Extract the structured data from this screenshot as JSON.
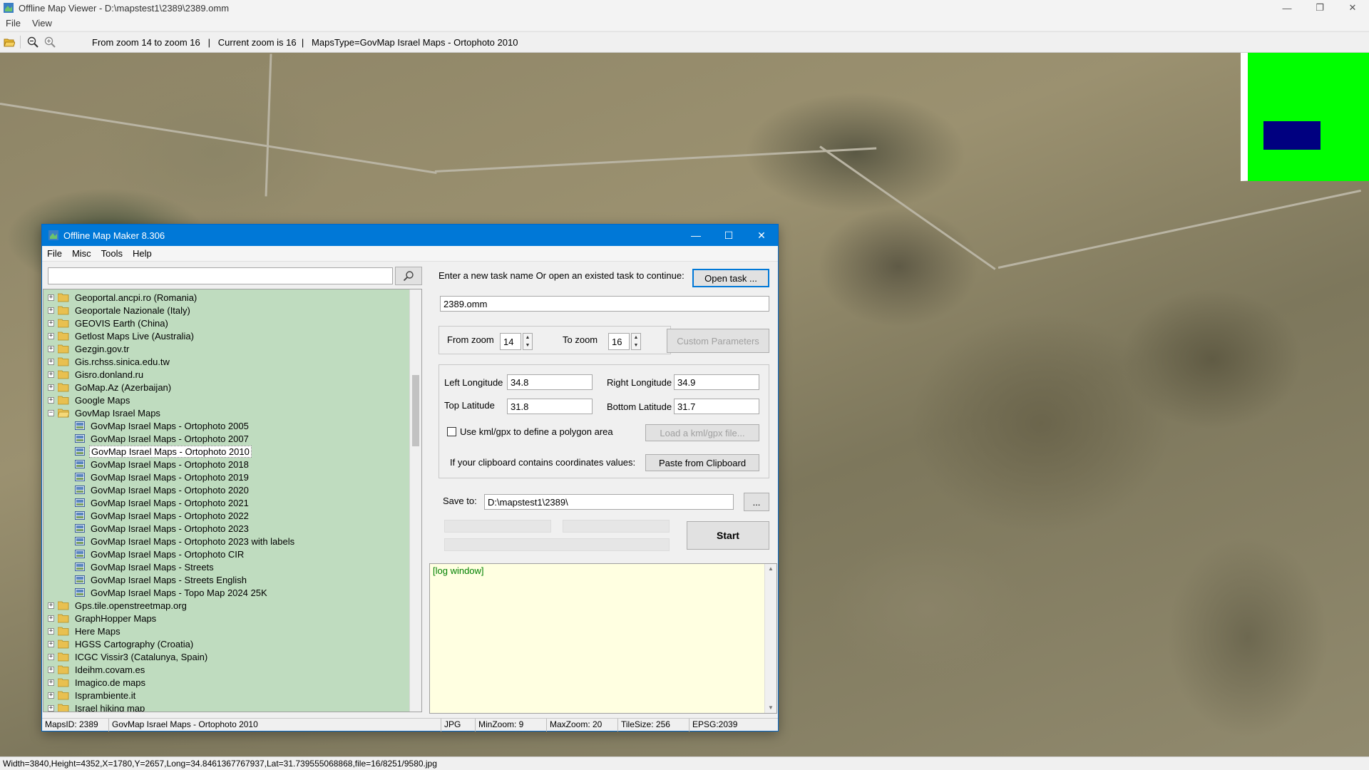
{
  "viewer": {
    "title": "Offline Map Viewer - D:\\mapstest1\\2389\\2389.omm",
    "menu": [
      "File",
      "View"
    ],
    "toolbar_info": "From zoom 14 to zoom 16   |   Current zoom is 16  |   MapsType=GovMap Israel Maps - Ortophoto 2010",
    "status": "Width=3840,Height=4352,X=1780,Y=2657,Long=34.8461367767937,Lat=31.739555068868,file=16/8251/9580.jpg"
  },
  "dialog": {
    "title": "Offline Map Maker 8.306",
    "menu": [
      "File",
      "Misc",
      "Tools",
      "Help"
    ],
    "search": {
      "value": "",
      "placeholder": ""
    },
    "tree": [
      {
        "label": "Geoportal.ancpi.ro (Romania)",
        "type": "folder",
        "level": 0,
        "expander": "+"
      },
      {
        "label": "Geoportale Nazionale (Italy)",
        "type": "folder",
        "level": 0,
        "expander": "+"
      },
      {
        "label": "GEOVIS Earth (China)",
        "type": "folder",
        "level": 0,
        "expander": "+"
      },
      {
        "label": "Getlost Maps Live (Australia)",
        "type": "folder",
        "level": 0,
        "expander": "+"
      },
      {
        "label": "Gezgin.gov.tr",
        "type": "folder",
        "level": 0,
        "expander": "+"
      },
      {
        "label": "Gis.rchss.sinica.edu.tw",
        "type": "folder",
        "level": 0,
        "expander": "+"
      },
      {
        "label": "Gisro.donland.ru",
        "type": "folder",
        "level": 0,
        "expander": "+"
      },
      {
        "label": "GoMap.Az (Azerbaijan)",
        "type": "folder",
        "level": 0,
        "expander": "+"
      },
      {
        "label": "Google Maps",
        "type": "folder",
        "level": 0,
        "expander": "+"
      },
      {
        "label": "GovMap Israel Maps",
        "type": "folder-open",
        "level": 0,
        "expander": "−"
      },
      {
        "label": "GovMap Israel Maps - Ortophoto 2005",
        "type": "map",
        "level": 1
      },
      {
        "label": "GovMap Israel Maps - Ortophoto 2007",
        "type": "map",
        "level": 1
      },
      {
        "label": "GovMap Israel Maps - Ortophoto 2010",
        "type": "map",
        "level": 1,
        "selected": true
      },
      {
        "label": "GovMap Israel Maps - Ortophoto 2018",
        "type": "map",
        "level": 1
      },
      {
        "label": "GovMap Israel Maps - Ortophoto 2019",
        "type": "map",
        "level": 1
      },
      {
        "label": "GovMap Israel Maps - Ortophoto 2020",
        "type": "map",
        "level": 1
      },
      {
        "label": "GovMap Israel Maps - Ortophoto 2021",
        "type": "map",
        "level": 1
      },
      {
        "label": "GovMap Israel Maps - Ortophoto 2022",
        "type": "map",
        "level": 1
      },
      {
        "label": "GovMap Israel Maps - Ortophoto 2023",
        "type": "map",
        "level": 1
      },
      {
        "label": "GovMap Israel Maps - Ortophoto 2023 with labels",
        "type": "map",
        "level": 1
      },
      {
        "label": "GovMap Israel Maps - Ortophoto CIR",
        "type": "map",
        "level": 1
      },
      {
        "label": "GovMap Israel Maps - Streets",
        "type": "map",
        "level": 1
      },
      {
        "label": "GovMap Israel Maps - Streets English",
        "type": "map",
        "level": 1
      },
      {
        "label": "GovMap Israel Maps - Topo Map 2024 25K",
        "type": "map",
        "level": 1
      },
      {
        "label": "Gps.tile.openstreetmap.org",
        "type": "folder",
        "level": 0,
        "expander": "+"
      },
      {
        "label": "GraphHopper Maps",
        "type": "folder",
        "level": 0,
        "expander": "+"
      },
      {
        "label": "Here Maps",
        "type": "folder",
        "level": 0,
        "expander": "+"
      },
      {
        "label": "HGSS Cartography (Croatia)",
        "type": "folder",
        "level": 0,
        "expander": "+"
      },
      {
        "label": "ICGC Vissir3 (Catalunya, Spain)",
        "type": "folder",
        "level": 0,
        "expander": "+"
      },
      {
        "label": "Ideihm.covam.es",
        "type": "folder",
        "level": 0,
        "expander": "+"
      },
      {
        "label": "Imagico.de maps",
        "type": "folder",
        "level": 0,
        "expander": "+"
      },
      {
        "label": "Isprambiente.it",
        "type": "folder",
        "level": 0,
        "expander": "+"
      },
      {
        "label": "Israel hiking map",
        "type": "folder",
        "level": 0,
        "expander": "+"
      }
    ],
    "task_prompt": "Enter a new task name Or open an existed task to continue:",
    "open_task_label": "Open task ...",
    "task_name": "2389.omm",
    "from_zoom_label": "From zoom",
    "from_zoom": "14",
    "to_zoom_label": "To zoom",
    "to_zoom": "16",
    "custom_params_label": "Custom Parameters",
    "left_long_label": "Left Longitude",
    "left_long": "34.8",
    "right_long_label": "Right Longitude",
    "right_long": "34.9",
    "top_lat_label": "Top Latitude",
    "top_lat": "31.8",
    "bottom_lat_label": "Bottom Latitude",
    "bottom_lat": "31.7",
    "kml_checkbox_label": "Use kml/gpx to define a polygon area",
    "load_kml_label": "Load a kml/gpx file...",
    "clipboard_text": "If your clipboard contains coordinates values:",
    "paste_label": "Paste from Clipboard",
    "save_to_label": "Save to:",
    "save_to": "D:\\mapstest1\\2389\\",
    "browse_label": "...",
    "start_label": "Start",
    "log_text": "[log window]",
    "status": {
      "maps_id": "MapsID: 2389",
      "maps_name": "GovMap Israel Maps - Ortophoto 2010",
      "format": "JPG",
      "min_zoom": "MinZoom: 9",
      "max_zoom": "MaxZoom: 20",
      "tile_size": "TileSize: 256",
      "epsg": "EPSG:2039"
    }
  },
  "colors": {
    "dialog_title": "#0078d7",
    "tree_bg": "#bfdcbf",
    "log_bg": "#ffffe1",
    "minimap_area": "#00ff00",
    "minimap_view": "#000080"
  }
}
